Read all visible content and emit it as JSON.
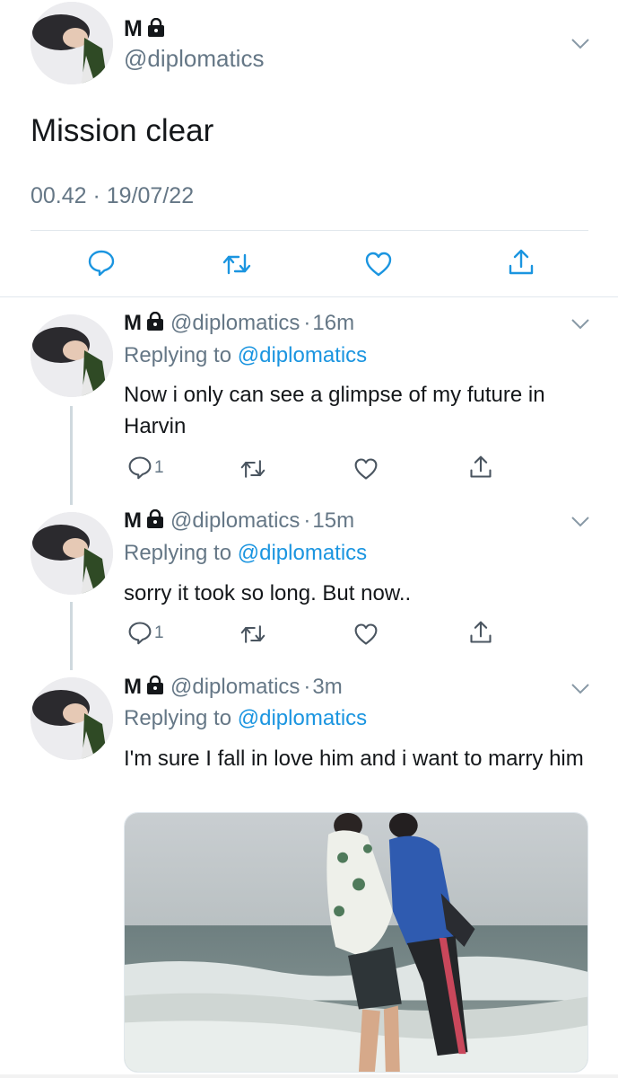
{
  "main_tweet": {
    "name": "M",
    "handle": "@diplomatics",
    "text": "Mission clear",
    "timestamp": "00.42 · 19/07/22",
    "actions": [
      "reply-icon",
      "retweet-icon",
      "like-icon",
      "share-icon"
    ]
  },
  "replies": [
    {
      "name": "M",
      "handle": "@diplomatics",
      "time": "16m",
      "replying_prefix": "Replying to",
      "replying_to": "@diplomatics",
      "text": "Now i only can see a glimpse of my future in Harvin",
      "reply_count": "1"
    },
    {
      "name": "M",
      "handle": "@diplomatics",
      "time": "15m",
      "replying_prefix": "Replying to",
      "replying_to": "@diplomatics",
      "text": "sorry it took so long. But now..",
      "reply_count": "1"
    },
    {
      "name": "M",
      "handle": "@diplomatics",
      "time": "3m",
      "replying_prefix": "Replying to",
      "replying_to": "@diplomatics",
      "text": "I'm sure I fall in love him and i want to marry him",
      "has_media": true
    }
  ],
  "colors": {
    "text": "#14171a",
    "secondary": "#657786",
    "link": "#1b95e0",
    "divider": "#e1e8ed"
  }
}
